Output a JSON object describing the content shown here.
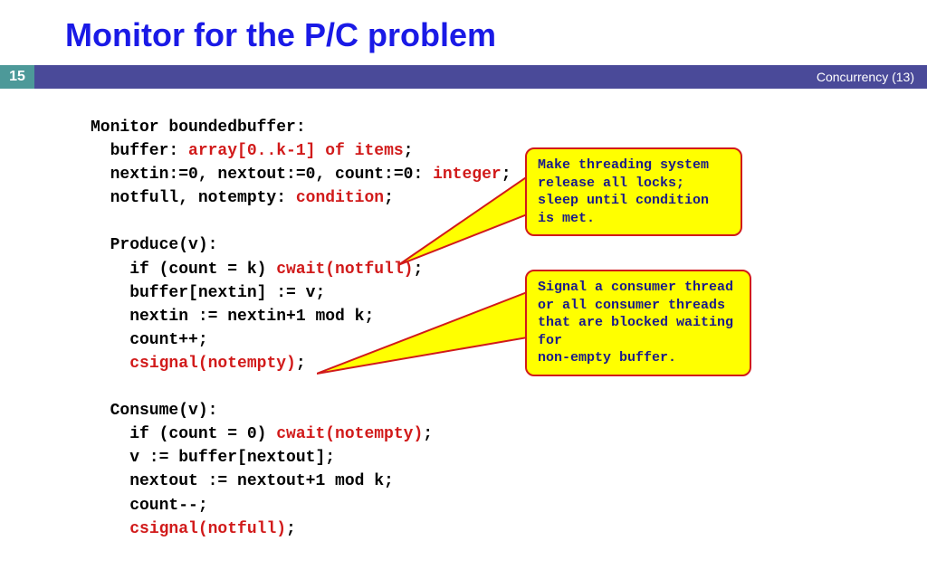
{
  "title": "Monitor for the P/C problem",
  "pagenum": "15",
  "bar_right": "Concurrency (13)",
  "code": {
    "l1": "Monitor boundedbuffer:",
    "l2a": "  buffer: ",
    "l2b": "array[0..k-1] of items",
    "l2c": ";",
    "l3a": "  nextin:=0, nextout:=0, count:=0: ",
    "l3b": "integer",
    "l3c": ";",
    "l4a": "  notfull, notempty: ",
    "l4b": "condition",
    "l4c": ";",
    "l5": "",
    "l6": "  Produce(v):",
    "l7a": "    if (count = k) ",
    "l7b": "cwait(notfull)",
    "l7c": ";",
    "l8": "    buffer[nextin] := v;",
    "l9": "    nextin := nextin+1 mod k;",
    "l10": "    count++;",
    "l11a": "    ",
    "l11b": "csignal(notempty)",
    "l11c": ";",
    "l12": "",
    "l13": "  Consume(v):",
    "l14a": "    if (count = 0) ",
    "l14b": "cwait(notempty)",
    "l14c": ";",
    "l15": "    v := buffer[nextout];",
    "l16": "    nextout := nextout+1 mod k;",
    "l17": "    count--;",
    "l18a": "    ",
    "l18b": "csignal(notfull)",
    "l18c": ";"
  },
  "callout1": {
    "line1": "Make threading system",
    "line2": "release all locks;",
    "line3": "sleep until condition is met."
  },
  "callout2": {
    "line1": "Signal a consumer thread",
    "line2": "or all consumer threads",
    "line3": "that are blocked waiting for",
    "line4": "non-empty buffer."
  }
}
